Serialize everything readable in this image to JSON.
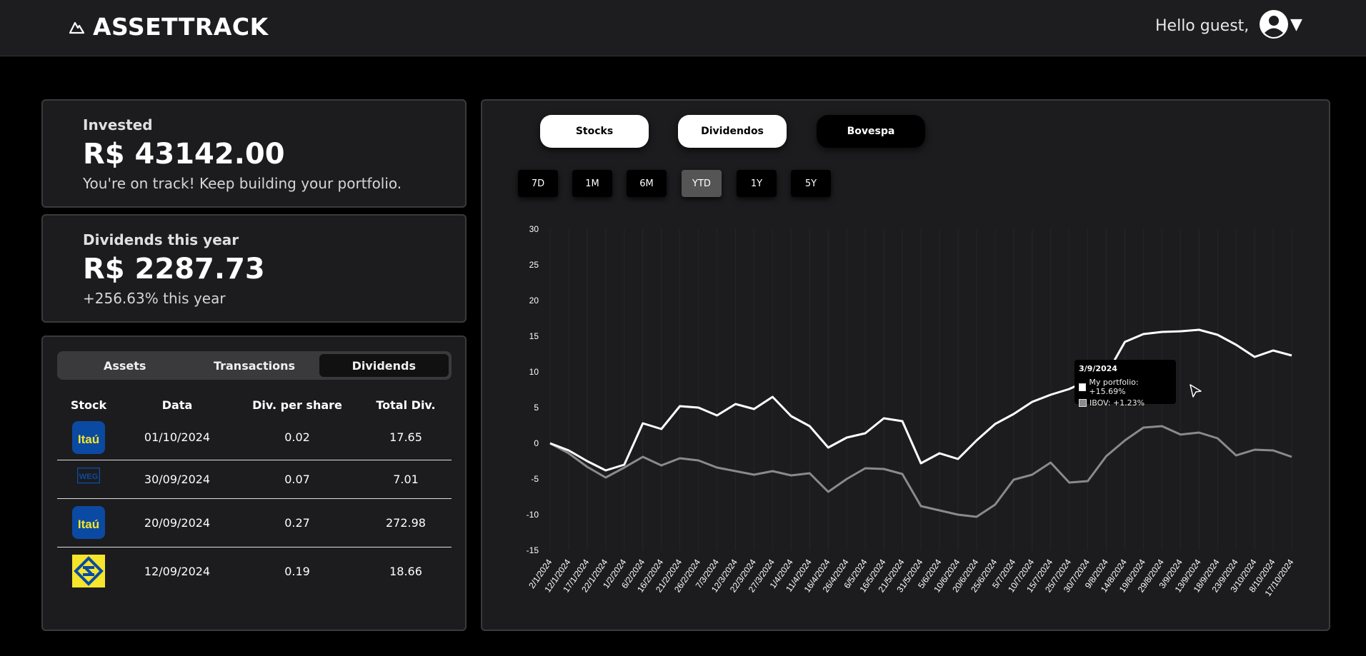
{
  "app": {
    "name": "ASSETTRACK",
    "greeting": "Hello guest,"
  },
  "summary": {
    "invested": {
      "label": "Invested",
      "value": "R$ 43142.00",
      "note": "You're on track! Keep building your portfolio."
    },
    "dividends": {
      "label": "Dividends this year",
      "value": "R$ 2287.73",
      "note": "+256.63% this year"
    }
  },
  "panel": {
    "tabs": [
      "Assets",
      "Transactions",
      "Dividends"
    ],
    "active_tab": "Dividends",
    "columns": [
      "Stock",
      "Data",
      "Div. per share",
      "Total Div."
    ],
    "rows": [
      {
        "logo": "itau-logo",
        "logo_text": "Itaú",
        "date": "01/10/2024",
        "per_share": "0.02",
        "total": "17.65"
      },
      {
        "logo": "weg-logo",
        "logo_text": "WEG",
        "date": "30/09/2024",
        "per_share": "0.07",
        "total": "7.01"
      },
      {
        "logo": "itau-logo",
        "logo_text": "Itaú",
        "date": "20/09/2024",
        "per_share": "0.27",
        "total": "272.98"
      },
      {
        "logo": "banco-do-brasil-logo",
        "logo_text": "",
        "date": "12/09/2024",
        "per_share": "0.19",
        "total": "18.66"
      }
    ]
  },
  "chart_controls": {
    "segments": [
      "Stocks",
      "Dividendos",
      "Bovespa"
    ],
    "ranges": [
      "7D",
      "1M",
      "6M",
      "YTD",
      "1Y",
      "5Y"
    ],
    "active_range": "YTD"
  },
  "tooltip": {
    "date": "3/9/2024",
    "portfolio": "My portfolio: +15.69%",
    "ibov": "IBOV: +1.23%"
  },
  "colors": {
    "portfolio": "#ffffff",
    "ibov": "#8a8a8a",
    "card_bg": "#1c1c1e",
    "accent_blue": "#0b4aa2",
    "accent_yellow": "#f5e52b"
  },
  "chart_data": {
    "type": "line",
    "ylim": [
      -15,
      30
    ],
    "yticks": [
      30,
      25,
      20,
      15,
      10,
      5,
      0,
      -5,
      -10,
      -15
    ],
    "x": [
      "2/1/2024",
      "12/1/2024",
      "17/1/2024",
      "22/1/2024",
      "1/2/2024",
      "6/2/2024",
      "16/2/2024",
      "21/2/2024",
      "26/2/2024",
      "7/3/2024",
      "12/3/2024",
      "22/3/2024",
      "27/3/2024",
      "1/4/2024",
      "11/4/2024",
      "16/4/2024",
      "26/4/2024",
      "6/5/2024",
      "16/5/2024",
      "21/5/2024",
      "31/5/2024",
      "5/6/2024",
      "10/6/2024",
      "20/6/2024",
      "25/6/2024",
      "5/7/2024",
      "10/7/2024",
      "15/7/2024",
      "25/7/2024",
      "30/7/2024",
      "9/8/2024",
      "14/8/2024",
      "19/8/2024",
      "29/8/2024",
      "3/9/2024",
      "13/9/2024",
      "18/9/2024",
      "23/9/2024",
      "3/10/2024",
      "8/10/2024",
      "17/10/2024"
    ],
    "series": [
      {
        "name": "My portfolio",
        "values": [
          0,
          -1,
          -2.5,
          -3.8,
          -3,
          2.8,
          2,
          5.2,
          5,
          3.9,
          5.5,
          4.8,
          6.5,
          3.8,
          2.4,
          -0.6,
          0.8,
          1.4,
          3.5,
          3.1,
          -2.8,
          -1.4,
          -2.2,
          0.4,
          2.7,
          4.1,
          5.8,
          6.8,
          7.6,
          8.8,
          9.6,
          14.2,
          15.3,
          15.6,
          15.69,
          15.9,
          15.2,
          13.8,
          12.1,
          13,
          12.3
        ]
      },
      {
        "name": "IBOV",
        "values": [
          0,
          -1.4,
          -3.3,
          -4.8,
          -3.4,
          -1.9,
          -3.1,
          -2.1,
          -2.4,
          -3.4,
          -3.9,
          -4.4,
          -3.9,
          -4.5,
          -4.2,
          -6.8,
          -5,
          -3.5,
          -3.6,
          -4.3,
          -8.8,
          -9.4,
          -10,
          -10.3,
          -8.6,
          -5.1,
          -4.4,
          -2.7,
          -5.5,
          -5.3,
          -1.8,
          0.4,
          2.2,
          2.4,
          1.23,
          1.5,
          0.7,
          -1.7,
          -0.9,
          -1,
          -1.9
        ]
      }
    ]
  }
}
